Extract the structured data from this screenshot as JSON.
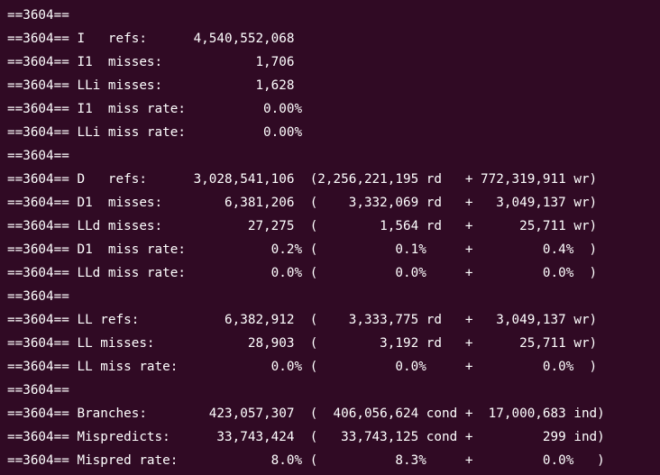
{
  "terminal": {
    "colors": {
      "background": "#300a24",
      "foreground": "#ffffff"
    },
    "lines": [
      "==3604==",
      "==3604== I   refs:      4,540,552,068",
      "==3604== I1  misses:            1,706",
      "==3604== LLi misses:            1,628",
      "==3604== I1  miss rate:          0.00%",
      "==3604== LLi miss rate:          0.00%",
      "==3604==",
      "==3604== D   refs:      3,028,541,106  (2,256,221,195 rd   + 772,319,911 wr)",
      "==3604== D1  misses:        6,381,206  (    3,332,069 rd   +   3,049,137 wr)",
      "==3604== LLd misses:           27,275  (        1,564 rd   +      25,711 wr)",
      "==3604== D1  miss rate:           0.2% (          0.1%     +         0.4%  )",
      "==3604== LLd miss rate:           0.0% (          0.0%     +         0.0%  )",
      "==3604==",
      "==3604== LL refs:           6,382,912  (    3,333,775 rd   +   3,049,137 wr)",
      "==3604== LL misses:            28,903  (        3,192 rd   +      25,711 wr)",
      "==3604== LL miss rate:            0.0% (          0.0%     +         0.0%  )",
      "==3604==",
      "==3604== Branches:        423,057,307  (  406,056,624 cond +  17,000,683 ind)",
      "==3604== Mispredicts:      33,743,424  (   33,743,125 cond +         299 ind)",
      "==3604== Mispred rate:            8.0% (          8.3%     +         0.0%   )"
    ]
  }
}
